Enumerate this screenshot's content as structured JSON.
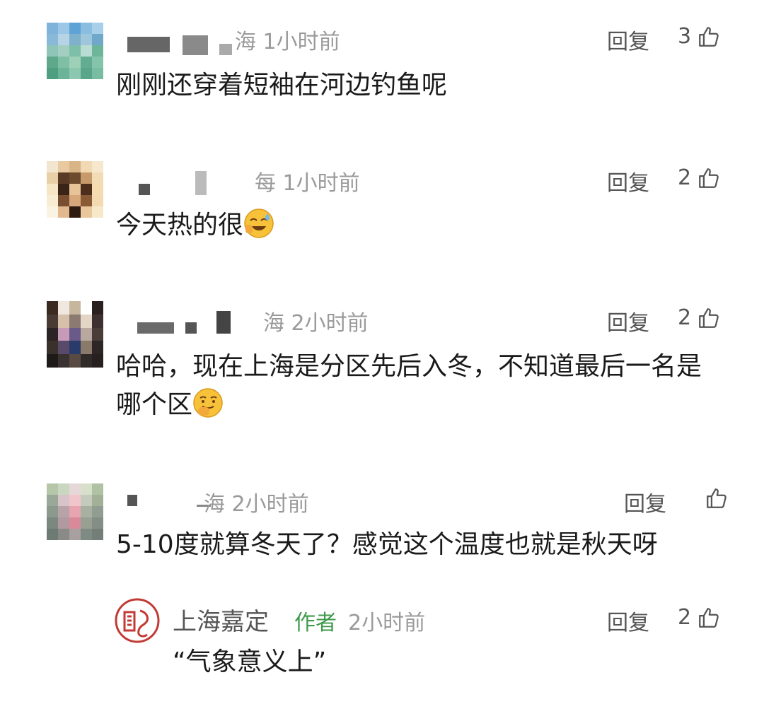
{
  "reply_label": "回复",
  "comments": [
    {
      "meta": "海 1小时前",
      "likes": "3",
      "text": "刚刚还穿着短袖在河边钓鱼呢"
    },
    {
      "meta": "每 1小时前",
      "likes": "2",
      "text": "今天热的很"
    },
    {
      "meta": "海 2小时前",
      "likes": "2",
      "text": "哈哈，现在上海是分区先后入冬，不知道最后一名是哪个区"
    },
    {
      "meta": "海 2小时前",
      "likes": "",
      "text": "5-10度就算冬天了？感觉这个温度也就是秋天呀"
    }
  ],
  "author_reply": {
    "name": "上海嘉定",
    "tag": "作者",
    "time": "2小时前",
    "likes": "2",
    "text": "“气象意义上”"
  },
  "colors": {
    "author_tag": "#3f9a4a",
    "meta": "#9a9a9a"
  },
  "icons": {
    "like": "thumbs-up-icon",
    "author_avatar": "seal-logo"
  }
}
